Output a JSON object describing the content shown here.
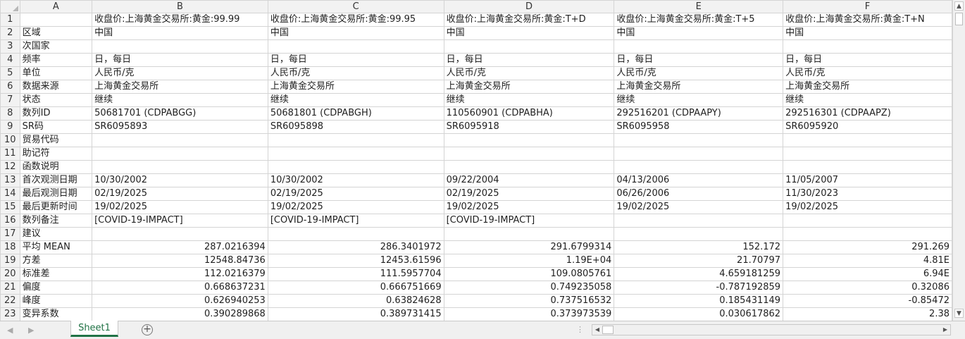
{
  "columns": [
    "A",
    "B",
    "C",
    "D",
    "E",
    "F"
  ],
  "rows": [
    {
      "num": "1",
      "cells": [
        "",
        "收盘价:上海黄金交易所:黄金:99.99",
        "收盘价:上海黄金交易所:黄金:99.95",
        "收盘价:上海黄金交易所:黄金:T+D",
        "收盘价:上海黄金交易所:黄金:T+5",
        "收盘价:上海黄金交易所:黄金:T+N"
      ]
    },
    {
      "num": "2",
      "cells": [
        "区域",
        "中国",
        "中国",
        "中国",
        "中国",
        "中国"
      ]
    },
    {
      "num": "3",
      "cells": [
        "次国家",
        "",
        "",
        "",
        "",
        ""
      ]
    },
    {
      "num": "4",
      "cells": [
        "频率",
        "日，每日",
        "日，每日",
        "日，每日",
        "日，每日",
        "日，每日"
      ]
    },
    {
      "num": "5",
      "cells": [
        "单位",
        "人民币/克",
        "人民币/克",
        "人民币/克",
        "人民币/克",
        "人民币/克"
      ]
    },
    {
      "num": "6",
      "cells": [
        "数据来源",
        "上海黄金交易所",
        "上海黄金交易所",
        "上海黄金交易所",
        "上海黄金交易所",
        "上海黄金交易所"
      ]
    },
    {
      "num": "7",
      "cells": [
        "状态",
        "继续",
        "继续",
        "继续",
        "继续",
        "继续"
      ]
    },
    {
      "num": "8",
      "cells": [
        "数列ID",
        "50681701 (CDPABGG)",
        "50681801 (CDPABGH)",
        "110560901 (CDPABHA)",
        "292516201 (CDPAAPY)",
        "292516301 (CDPAAPZ)"
      ]
    },
    {
      "num": "9",
      "cells": [
        "SR码",
        "SR6095893",
        "SR6095898",
        "SR6095918",
        "SR6095958",
        "SR6095920"
      ]
    },
    {
      "num": "10",
      "cells": [
        "贸易代码",
        "",
        "",
        "",
        "",
        ""
      ]
    },
    {
      "num": "11",
      "cells": [
        "助记符",
        "",
        "",
        "",
        "",
        ""
      ]
    },
    {
      "num": "12",
      "cells": [
        "函数说明",
        "",
        "",
        "",
        "",
        ""
      ]
    },
    {
      "num": "13",
      "cells": [
        "首次观测日期",
        "10/30/2002",
        "10/30/2002",
        "09/22/2004",
        "04/13/2006",
        "11/05/2007"
      ]
    },
    {
      "num": "14",
      "cells": [
        "最后观测日期",
        "02/19/2025",
        "02/19/2025",
        "02/19/2025",
        "06/26/2006",
        "11/30/2023"
      ]
    },
    {
      "num": "15",
      "cells": [
        "最后更新时间",
        "19/02/2025",
        "19/02/2025",
        "19/02/2025",
        "19/02/2025",
        "19/02/2025"
      ]
    },
    {
      "num": "16",
      "cells": [
        "数列备注",
        "[COVID-19-IMPACT]",
        "[COVID-19-IMPACT]",
        "[COVID-19-IMPACT]",
        "",
        ""
      ]
    },
    {
      "num": "17",
      "cells": [
        "建议",
        "",
        "",
        "",
        "",
        ""
      ]
    },
    {
      "num": "18",
      "numeric": true,
      "cells": [
        "平均 MEAN",
        "287.0216394",
        "286.3401972",
        "291.6799314",
        "152.172",
        "291.269"
      ]
    },
    {
      "num": "19",
      "numeric": true,
      "cells": [
        "方差",
        "12548.84736",
        "12453.61596",
        "1.19E+04",
        "21.70797",
        "4.81E"
      ]
    },
    {
      "num": "20",
      "numeric": true,
      "cells": [
        "标准差",
        "112.0216379",
        "111.5957704",
        "109.0805761",
        "4.659181259",
        "6.94E"
      ]
    },
    {
      "num": "21",
      "numeric": true,
      "cells": [
        "偏度",
        "0.668637231",
        "0.666751669",
        "0.749235058",
        "-0.787192859",
        "0.32086"
      ]
    },
    {
      "num": "22",
      "numeric": true,
      "cells": [
        "峰度",
        "0.626940253",
        "0.63824628",
        "0.737516532",
        "0.185431149",
        "-0.85472"
      ]
    },
    {
      "num": "23",
      "numeric": true,
      "cells": [
        "变异系数",
        "0.390289868",
        "0.389731415",
        "0.373973539",
        "0.030617862",
        "2.38"
      ]
    }
  ],
  "sheet_tab": "Sheet1",
  "add_sheet_label": "+",
  "accent_color": "#217346"
}
